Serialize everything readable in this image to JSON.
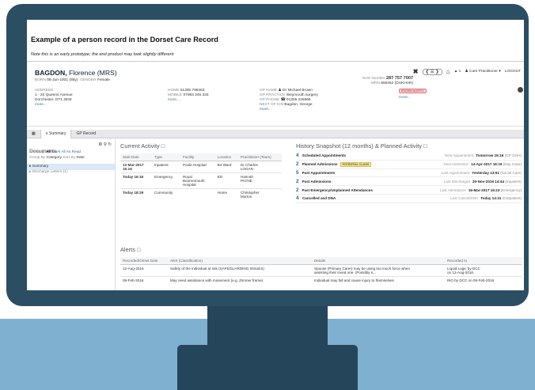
{
  "document": {
    "title": "Example of a person record in the Dorset Care Record",
    "note": "Note this is an early prototype; the end product may look slightly different"
  },
  "patient": {
    "surname": "BAGDON,",
    "given": "Florence (MRS)",
    "born_label": "BORN",
    "born": "05-Jun-1931 (85y)",
    "gender_label": "GENDER",
    "gender": "Female",
    "address_label": "ADDRESS",
    "address_1": "1 - 20 Queens Avenue",
    "address_2": "Dorchester, DT1 2EW",
    "more": "more...",
    "home_label": "HOME",
    "home": "01305 796463",
    "mobile_label": "MOBILE",
    "mobile": "07993 345 345",
    "gp_name_label": "GP NAME",
    "gp_name": "Dr Michael Brown",
    "gp_practice_label": "GP PRACTICE",
    "gp_practice": "Weymouth surgery",
    "gp_phone_label": "GP PHONE",
    "gp_phone": "01305 225566",
    "nok_label": "NEXT OF KIN",
    "nok": "Bagdon, George",
    "nhs_label": "NHS Number",
    "nhs": "287 757 7007",
    "mrn_label": "MRN",
    "mrn": "856352 (DUKHAR)",
    "alerts_badge": "KNOWN ALERTS"
  },
  "toolbar": {
    "close": "✖",
    "notify_count": "1",
    "user": "Care Practitioner",
    "logout": "LOGOUT"
  },
  "tabs": [
    {
      "label": "Summary"
    },
    {
      "label": "GP Record"
    }
  ],
  "documents": {
    "title": "Documents",
    "showing_label": "Showing:",
    "showing": "All",
    "mark_read": "Mark All As Read",
    "group_label": "Group By",
    "group": "Category",
    "sort_label": "Sort By",
    "sort": "Date",
    "items": [
      {
        "label": "Summary"
      },
      {
        "label": "Discharge Letters (1)"
      }
    ]
  },
  "current_activity": {
    "title": "Current Activity",
    "headers": [
      "Start Date",
      "Type",
      "Facility",
      "Location",
      "Practitioner (Team)"
    ],
    "rows": [
      {
        "date": "12-Mar-2017",
        "date2": "15:16",
        "type": "Inpatient",
        "facility": "Poole Hospital",
        "location": "B4 Ward",
        "pract": "Dr Charles",
        "pract2": "LOGAN"
      },
      {
        "date": "Today 16:16",
        "type": "Emergency",
        "facility": "Royal",
        "facility2": "Bournemouth",
        "facility3": "Hospital",
        "location": "ED",
        "pract": "Hannah",
        "pract2": "PAYNE"
      },
      {
        "date": "Today 18:29",
        "type": "Community",
        "facility": "",
        "location": "Home",
        "pract": "Christopher",
        "pract2": "Morton"
      }
    ]
  },
  "history": {
    "title": "History Snapshot (12 months) & Planned Activity",
    "rows": [
      {
        "n": "4",
        "label": "Scheduled Appointments",
        "sub": "Next Appointment",
        "value": "Tomorrow 15:16",
        "value_note": "(GP OOH)"
      },
      {
        "n": "2",
        "label": "Planned Admissions",
        "badge": "POTENTIAL CLASH",
        "sub": "Next Admission",
        "value": "14-Apr-2017 16:16",
        "value_note": "(Day Case)"
      },
      {
        "n": "5",
        "label": "Past Appointments",
        "sub": "Last Appointment",
        "value": "Yesterday 13:51",
        "value_note": "(Social Care)"
      },
      {
        "n": "2",
        "label": "Past Admissions",
        "sub": "Last Discharged",
        "value": "20-Nov-2016 14:44",
        "value_note": "(Inpatient)"
      },
      {
        "n": "2",
        "label": "Past Emergency/Unplanned Attendances",
        "sub": "Last Attendance",
        "value": "16-Mar-2017 16:23",
        "value_note": "(Emergency)"
      },
      {
        "n": "4",
        "label": "Cancelled and DNA",
        "sub": "Last Cancel/DNA",
        "value": "Today 14:31",
        "value_note": "(Outpatient)"
      }
    ]
  },
  "alerts": {
    "title": "Alerts",
    "headers": [
      "Recorded/Onset Date",
      "Alert (Classification)",
      "Details",
      "Recorded In"
    ],
    "rows": [
      {
        "date": "12-Aug-2016",
        "alert": "Safety of the individual at risk (SAFEGUARDING ISSUES)",
        "details": "Spouse (Primary Carer) may be using too much force when",
        "details2": "assisting their loved one. (Possibly s...",
        "recorded": "Liquid Logic by DCC",
        "recorded2": "on 12-Aug-2016"
      },
      {
        "date": "08-Feb-2016",
        "alert": "May need assistance with movement (e.g. Zimmer frame)",
        "details": "Individual may fall and cause injury to themselves",
        "recorded": "RiO by DCC on 08-Feb-2016"
      }
    ]
  }
}
